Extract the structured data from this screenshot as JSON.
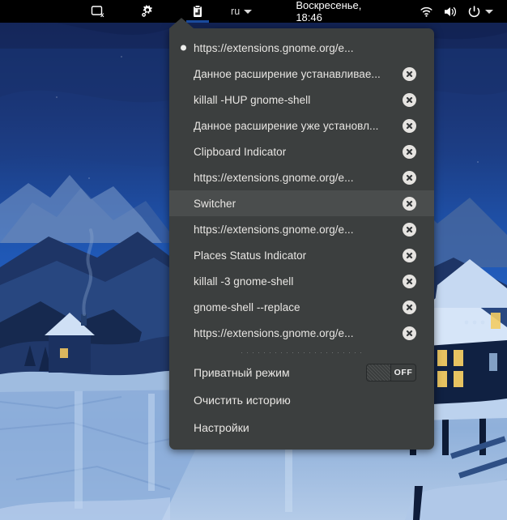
{
  "topbar": {
    "background": "#000000",
    "accent": "#1b4b9e",
    "items": [
      {
        "name": "touchpad-disabled-icon",
        "type": "icon",
        "icon": "touchpad-disabled-icon",
        "active": false
      },
      {
        "name": "settings-gear-icon",
        "type": "icon",
        "icon": "gear-icon",
        "active": false
      },
      {
        "name": "clipboard-indicator-icon",
        "type": "icon",
        "icon": "clipboard-icon",
        "active": true
      }
    ],
    "keyboard_layout": "ru",
    "clock": "Воскресенье, 18:46",
    "status_icons": [
      "wifi-icon",
      "volume-icon",
      "power-icon",
      "chevron-down-icon"
    ],
    "app_grid": "app-grid-icon"
  },
  "popup": {
    "background": "#3c3f3f",
    "hover_background": "#4a4d4d",
    "text_color": "#e8e6e3",
    "clipboard_items": [
      {
        "label": "https://extensions.gnome.org/e...",
        "current": true,
        "closable": false,
        "hovered": false
      },
      {
        "label": "Данное расширение устанавливае...",
        "current": false,
        "closable": true,
        "hovered": false
      },
      {
        "label": "killall -HUP gnome-shell",
        "current": false,
        "closable": true,
        "hovered": false
      },
      {
        "label": "Данное расширение уже установл...",
        "current": false,
        "closable": true,
        "hovered": false
      },
      {
        "label": "Clipboard Indicator",
        "current": false,
        "closable": true,
        "hovered": false
      },
      {
        "label": "https://extensions.gnome.org/e...",
        "current": false,
        "closable": true,
        "hovered": false
      },
      {
        "label": "Switcher",
        "current": false,
        "closable": true,
        "hovered": true
      },
      {
        "label": "https://extensions.gnome.org/e...",
        "current": false,
        "closable": true,
        "hovered": false
      },
      {
        "label": "Places Status Indicator",
        "current": false,
        "closable": true,
        "hovered": false
      },
      {
        "label": "killall -3 gnome-shell",
        "current": false,
        "closable": true,
        "hovered": false
      },
      {
        "label": "gnome-shell --replace",
        "current": false,
        "closable": true,
        "hovered": false
      },
      {
        "label": "https://extensions.gnome.org/e...",
        "current": false,
        "closable": true,
        "hovered": false
      }
    ],
    "private_mode": {
      "label": "Приватный режим",
      "state_label": "OFF",
      "enabled": false
    },
    "clear_history": {
      "label": "Очистить историю"
    },
    "settings": {
      "label": "Настройки"
    }
  }
}
